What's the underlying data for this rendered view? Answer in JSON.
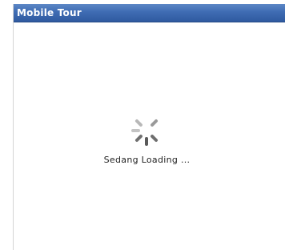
{
  "window": {
    "title": "Mobile Tour"
  },
  "loader": {
    "message": "Sedang Loading ...",
    "indicator": "spinner-icon"
  },
  "colors": {
    "title_bar": "#3f6cb3",
    "title_text": "#ffffff",
    "background": "#ffffff",
    "spinner": "#6a6a6a",
    "message_text": "#222222"
  }
}
